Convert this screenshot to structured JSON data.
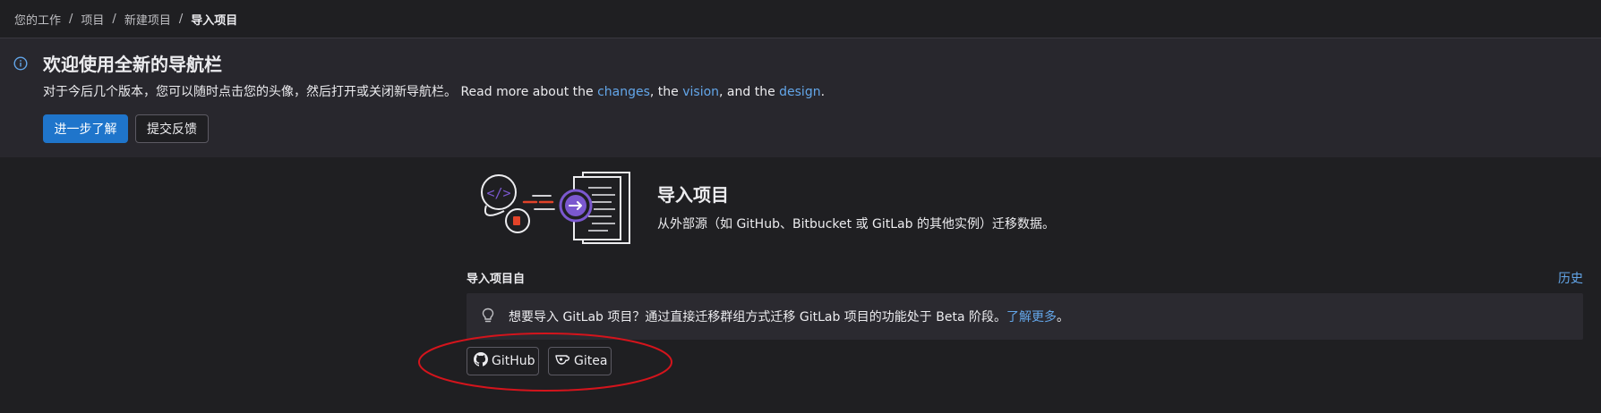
{
  "breadcrumb": {
    "items": [
      "您的工作",
      "项目",
      "新建项目"
    ],
    "current": "导入项目",
    "separator": "/"
  },
  "banner": {
    "title": "欢迎使用全新的导航栏",
    "text_prefix": "对于今后几个版本，您可以随时点击您的头像，然后打开或关闭新导航栏。 Read more about the ",
    "link_changes": "changes",
    "text_mid1": ", the ",
    "link_vision": "vision",
    "text_mid2": ", and the ",
    "link_design": "design",
    "text_suffix": ".",
    "learn_more_button": "进一步了解",
    "feedback_button": "提交反馈"
  },
  "main": {
    "title": "导入项目",
    "description": "从外部源（如 GitHub、Bitbucket 或 GitLab 的其他实例）迁移数据。",
    "import_from_label": "导入项目自",
    "history_link": "历史"
  },
  "alert": {
    "text": "想要导入 GitLab 项目？通过直接迁移群组方式迁移 GitLab 项目的功能处于 Beta 阶段。",
    "link": "了解更多",
    "suffix": "。"
  },
  "sources": {
    "github_label": "GitHub",
    "gitea_label": "Gitea"
  },
  "colors": {
    "background": "#1f1f22",
    "banner_bg": "#28272d",
    "link": "#63a6e9",
    "primary": "#1f75cb",
    "highlight": "#d4141c"
  },
  "icons": {
    "banner": "info-icon",
    "alert": "lightbulb-icon",
    "github": "github-icon",
    "gitea": "gitea-icon"
  }
}
